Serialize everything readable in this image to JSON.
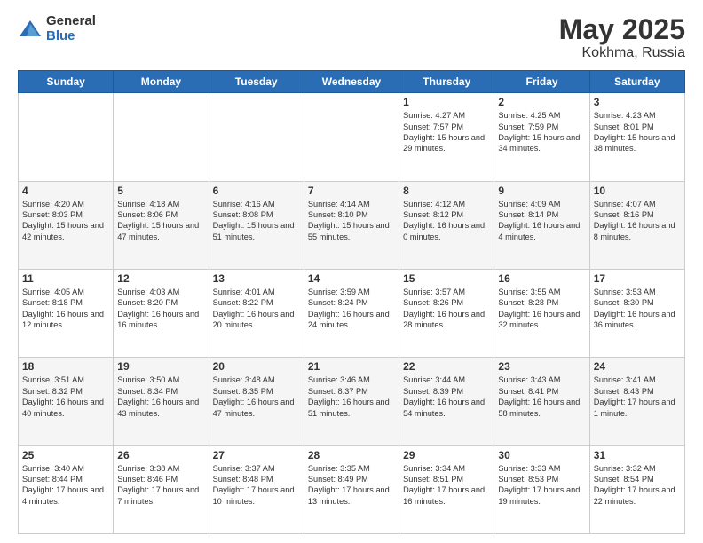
{
  "logo": {
    "general": "General",
    "blue": "Blue"
  },
  "title": {
    "month_year": "May 2025",
    "location": "Kokhma, Russia"
  },
  "weekdays": [
    "Sunday",
    "Monday",
    "Tuesday",
    "Wednesday",
    "Thursday",
    "Friday",
    "Saturday"
  ],
  "weeks": [
    [
      {
        "day": "",
        "sunrise": "",
        "sunset": "",
        "daylight": ""
      },
      {
        "day": "",
        "sunrise": "",
        "sunset": "",
        "daylight": ""
      },
      {
        "day": "",
        "sunrise": "",
        "sunset": "",
        "daylight": ""
      },
      {
        "day": "",
        "sunrise": "",
        "sunset": "",
        "daylight": ""
      },
      {
        "day": "1",
        "sunrise": "Sunrise: 4:27 AM",
        "sunset": "Sunset: 7:57 PM",
        "daylight": "Daylight: 15 hours and 29 minutes."
      },
      {
        "day": "2",
        "sunrise": "Sunrise: 4:25 AM",
        "sunset": "Sunset: 7:59 PM",
        "daylight": "Daylight: 15 hours and 34 minutes."
      },
      {
        "day": "3",
        "sunrise": "Sunrise: 4:23 AM",
        "sunset": "Sunset: 8:01 PM",
        "daylight": "Daylight: 15 hours and 38 minutes."
      }
    ],
    [
      {
        "day": "4",
        "sunrise": "Sunrise: 4:20 AM",
        "sunset": "Sunset: 8:03 PM",
        "daylight": "Daylight: 15 hours and 42 minutes."
      },
      {
        "day": "5",
        "sunrise": "Sunrise: 4:18 AM",
        "sunset": "Sunset: 8:06 PM",
        "daylight": "Daylight: 15 hours and 47 minutes."
      },
      {
        "day": "6",
        "sunrise": "Sunrise: 4:16 AM",
        "sunset": "Sunset: 8:08 PM",
        "daylight": "Daylight: 15 hours and 51 minutes."
      },
      {
        "day": "7",
        "sunrise": "Sunrise: 4:14 AM",
        "sunset": "Sunset: 8:10 PM",
        "daylight": "Daylight: 15 hours and 55 minutes."
      },
      {
        "day": "8",
        "sunrise": "Sunrise: 4:12 AM",
        "sunset": "Sunset: 8:12 PM",
        "daylight": "Daylight: 16 hours and 0 minutes."
      },
      {
        "day": "9",
        "sunrise": "Sunrise: 4:09 AM",
        "sunset": "Sunset: 8:14 PM",
        "daylight": "Daylight: 16 hours and 4 minutes."
      },
      {
        "day": "10",
        "sunrise": "Sunrise: 4:07 AM",
        "sunset": "Sunset: 8:16 PM",
        "daylight": "Daylight: 16 hours and 8 minutes."
      }
    ],
    [
      {
        "day": "11",
        "sunrise": "Sunrise: 4:05 AM",
        "sunset": "Sunset: 8:18 PM",
        "daylight": "Daylight: 16 hours and 12 minutes."
      },
      {
        "day": "12",
        "sunrise": "Sunrise: 4:03 AM",
        "sunset": "Sunset: 8:20 PM",
        "daylight": "Daylight: 16 hours and 16 minutes."
      },
      {
        "day": "13",
        "sunrise": "Sunrise: 4:01 AM",
        "sunset": "Sunset: 8:22 PM",
        "daylight": "Daylight: 16 hours and 20 minutes."
      },
      {
        "day": "14",
        "sunrise": "Sunrise: 3:59 AM",
        "sunset": "Sunset: 8:24 PM",
        "daylight": "Daylight: 16 hours and 24 minutes."
      },
      {
        "day": "15",
        "sunrise": "Sunrise: 3:57 AM",
        "sunset": "Sunset: 8:26 PM",
        "daylight": "Daylight: 16 hours and 28 minutes."
      },
      {
        "day": "16",
        "sunrise": "Sunrise: 3:55 AM",
        "sunset": "Sunset: 8:28 PM",
        "daylight": "Daylight: 16 hours and 32 minutes."
      },
      {
        "day": "17",
        "sunrise": "Sunrise: 3:53 AM",
        "sunset": "Sunset: 8:30 PM",
        "daylight": "Daylight: 16 hours and 36 minutes."
      }
    ],
    [
      {
        "day": "18",
        "sunrise": "Sunrise: 3:51 AM",
        "sunset": "Sunset: 8:32 PM",
        "daylight": "Daylight: 16 hours and 40 minutes."
      },
      {
        "day": "19",
        "sunrise": "Sunrise: 3:50 AM",
        "sunset": "Sunset: 8:34 PM",
        "daylight": "Daylight: 16 hours and 43 minutes."
      },
      {
        "day": "20",
        "sunrise": "Sunrise: 3:48 AM",
        "sunset": "Sunset: 8:35 PM",
        "daylight": "Daylight: 16 hours and 47 minutes."
      },
      {
        "day": "21",
        "sunrise": "Sunrise: 3:46 AM",
        "sunset": "Sunset: 8:37 PM",
        "daylight": "Daylight: 16 hours and 51 minutes."
      },
      {
        "day": "22",
        "sunrise": "Sunrise: 3:44 AM",
        "sunset": "Sunset: 8:39 PM",
        "daylight": "Daylight: 16 hours and 54 minutes."
      },
      {
        "day": "23",
        "sunrise": "Sunrise: 3:43 AM",
        "sunset": "Sunset: 8:41 PM",
        "daylight": "Daylight: 16 hours and 58 minutes."
      },
      {
        "day": "24",
        "sunrise": "Sunrise: 3:41 AM",
        "sunset": "Sunset: 8:43 PM",
        "daylight": "Daylight: 17 hours and 1 minute."
      }
    ],
    [
      {
        "day": "25",
        "sunrise": "Sunrise: 3:40 AM",
        "sunset": "Sunset: 8:44 PM",
        "daylight": "Daylight: 17 hours and 4 minutes."
      },
      {
        "day": "26",
        "sunrise": "Sunrise: 3:38 AM",
        "sunset": "Sunset: 8:46 PM",
        "daylight": "Daylight: 17 hours and 7 minutes."
      },
      {
        "day": "27",
        "sunrise": "Sunrise: 3:37 AM",
        "sunset": "Sunset: 8:48 PM",
        "daylight": "Daylight: 17 hours and 10 minutes."
      },
      {
        "day": "28",
        "sunrise": "Sunrise: 3:35 AM",
        "sunset": "Sunset: 8:49 PM",
        "daylight": "Daylight: 17 hours and 13 minutes."
      },
      {
        "day": "29",
        "sunrise": "Sunrise: 3:34 AM",
        "sunset": "Sunset: 8:51 PM",
        "daylight": "Daylight: 17 hours and 16 minutes."
      },
      {
        "day": "30",
        "sunrise": "Sunrise: 3:33 AM",
        "sunset": "Sunset: 8:53 PM",
        "daylight": "Daylight: 17 hours and 19 minutes."
      },
      {
        "day": "31",
        "sunrise": "Sunrise: 3:32 AM",
        "sunset": "Sunset: 8:54 PM",
        "daylight": "Daylight: 17 hours and 22 minutes."
      }
    ]
  ]
}
